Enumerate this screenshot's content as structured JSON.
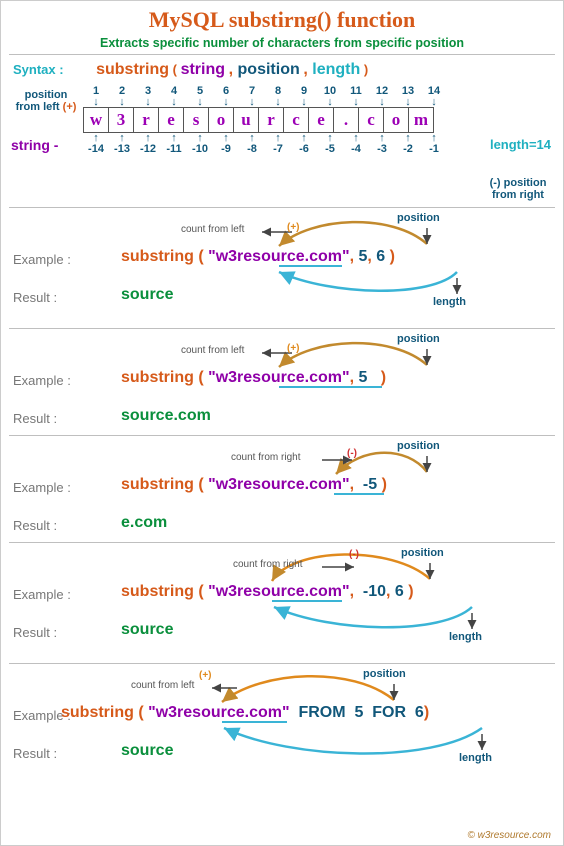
{
  "title": "MySQL substirng() function",
  "subtitle": "Extracts specific number of characters from specific position",
  "syntax": {
    "label": "Syntax :",
    "fn": "substring",
    "arg1": "string",
    "arg2": "position",
    "arg3": "length"
  },
  "grid": {
    "pos_from_left": "position from left",
    "plus": "(+)",
    "pos_from_right": "position from right",
    "minus": "(-)",
    "string_label": "string -",
    "length_label": "length=14",
    "chars": [
      "w",
      "3",
      "r",
      "e",
      "s",
      "o",
      "u",
      "r",
      "c",
      "e",
      ".",
      "c",
      "o",
      "m"
    ],
    "top_nums": [
      "1",
      "2",
      "3",
      "4",
      "5",
      "6",
      "7",
      "8",
      "9",
      "10",
      "11",
      "12",
      "13",
      "14"
    ],
    "bot_nums": [
      "-14",
      "-13",
      "-12",
      "-11",
      "-10",
      "-9",
      "-8",
      "-7",
      "-6",
      "-5",
      "-4",
      "-3",
      "-2",
      "-1"
    ]
  },
  "labels": {
    "example": "Example :",
    "result": "Result :",
    "count_left": "count from left",
    "count_right": "count from right",
    "position": "position",
    "length": "length",
    "plus": "(+)",
    "minus": "(-)"
  },
  "ex1": {
    "fn": "substring",
    "str": "\"w3resource.com\"",
    "pos": "5",
    "len": "6",
    "result": "source"
  },
  "ex2": {
    "fn": "substring",
    "str": "\"w3resource.com\"",
    "pos": "5",
    "result": "source.com"
  },
  "ex3": {
    "fn": "substring",
    "str": "\"w3resource.com\"",
    "pos": "-5",
    "result": "e.com"
  },
  "ex4": {
    "fn": "substring",
    "str": "\"w3resource.com\"",
    "pos": "-10",
    "len": "6",
    "result": "source"
  },
  "ex5": {
    "fn": "substring",
    "str": "\"w3resource.com\"",
    "from_kw": "FROM",
    "pos": "5",
    "for_kw": "FOR",
    "len": "6",
    "result": "source"
  },
  "footer": "© w3resource.com"
}
